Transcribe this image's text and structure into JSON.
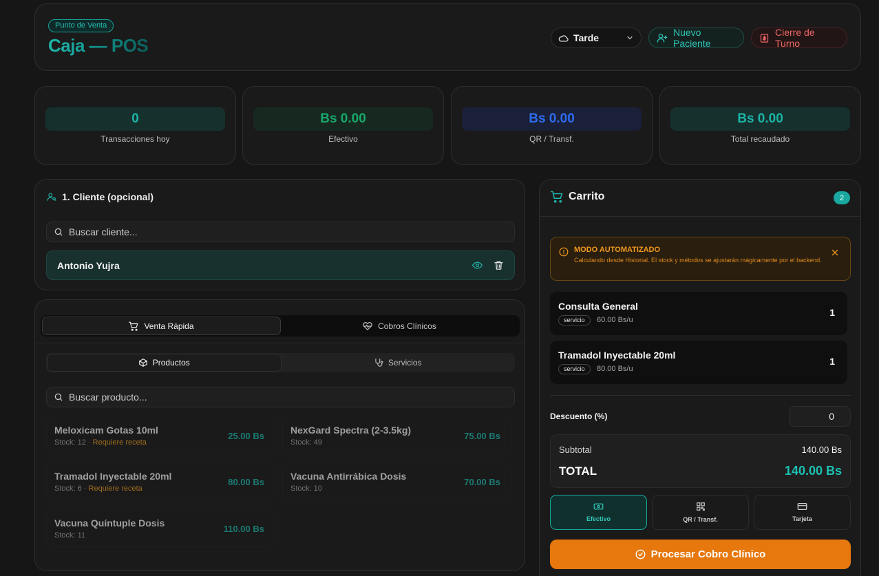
{
  "header": {
    "badge": "Punto de Venta",
    "title": "Caja — POS",
    "shift_value": "Tarde",
    "new_patient_label": "Nuevo Paciente",
    "close_shift_label": "Cierre de Turno"
  },
  "stats": [
    {
      "value": "0",
      "label": "Transacciones hoy",
      "color": "#1bb5a8"
    },
    {
      "value": "Bs 0.00",
      "label": "Efectivo",
      "color": "#18a86b"
    },
    {
      "value": "Bs 0.00",
      "label": "QR / Transf.",
      "color": "#2d6cf0"
    },
    {
      "value": "Bs 0.00",
      "label": "Total recaudado",
      "color": "#1bb5a8"
    }
  ],
  "client": {
    "title": "1. Cliente (opcional)",
    "search_placeholder": "Buscar cliente...",
    "selected_name": "Antonio Yujra"
  },
  "sale": {
    "tabs": [
      "Venta Rápida",
      "Cobros Clínicos"
    ],
    "subtabs": [
      "Productos",
      "Servicios"
    ],
    "search_placeholder": "Buscar producto...",
    "products": [
      {
        "name": "Meloxicam Gotas 10ml",
        "stock": "Stock: 12",
        "rx": "· Requiere receta",
        "price": "25.00 Bs"
      },
      {
        "name": "NexGard Spectra (2-3.5kg)",
        "stock": "Stock: 49",
        "rx": "",
        "price": "75.00 Bs"
      },
      {
        "name": "Tramadol Inyectable 20ml",
        "stock": "Stock: 6",
        "rx": "· Requiere receta",
        "price": "80.00 Bs"
      },
      {
        "name": "Vacuna Antirrábica Dosis",
        "stock": "Stock: 10",
        "rx": "",
        "price": "70.00 Bs"
      },
      {
        "name": "Vacuna Quíntuple Dosis",
        "stock": "Stock: 11",
        "rx": "",
        "price": "110.00 Bs"
      }
    ]
  },
  "cart": {
    "title": "Carrito",
    "count": "2",
    "banner_title": "MODO AUTOMATIZADO",
    "banner_text": "Calculando desde Historial. El stock y métodos se ajustarán mágicamente por el backend.",
    "items": [
      {
        "name": "Consulta General",
        "tag": "servicio",
        "unit_price": "60.00 Bs/u",
        "qty": "1"
      },
      {
        "name": "Tramadol Inyectable 20ml",
        "tag": "servicio",
        "unit_price": "80.00 Bs/u",
        "qty": "1"
      }
    ],
    "discount_label": "Descuento (%)",
    "discount_value": "0",
    "subtotal_label": "Subtotal",
    "subtotal_value": "140.00 Bs",
    "total_label": "TOTAL",
    "total_value": "140.00 Bs",
    "payment_methods": [
      "Efectivo",
      "QR / Transf.",
      "Tarjeta"
    ],
    "selected_method": "Efectivo",
    "process_label": "Procesar Cobro Clínico"
  }
}
